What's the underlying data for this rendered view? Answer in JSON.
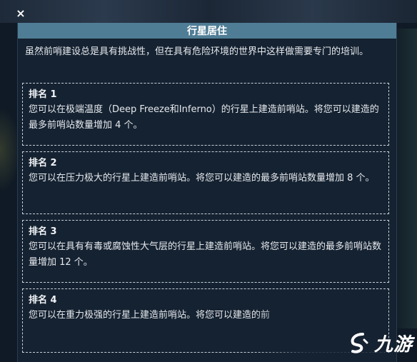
{
  "close_icon": "×",
  "panel": {
    "title": "行星居住",
    "intro": "虽然前哨建设总是具有挑战性，但在具有危险环境的世界中这样做需要专门的培训。"
  },
  "ranks": [
    {
      "title": "排名 1",
      "desc": "您可以在极端温度（Deep Freeze和Inferno）的行星上建造前哨站。将您可以建造的最多前哨站数量增加 4 个。"
    },
    {
      "title": "排名 2",
      "desc": "您可以在压力极大的行星上建造前哨站。将您可以建造的最多前哨站数量增加 8 个。"
    },
    {
      "title": "排名 3",
      "desc": "您可以在具有有毒或腐蚀性大气层的行星上建造前哨站。将您可以建造的最多前哨站数量增加 12 个。"
    },
    {
      "title": "排名 4",
      "desc": "您可以在重力极强的行星上建造前哨站。将您可以建造的前"
    }
  ],
  "watermark": {
    "text": "九游",
    "icon": "jiuyou-logo-icon"
  }
}
